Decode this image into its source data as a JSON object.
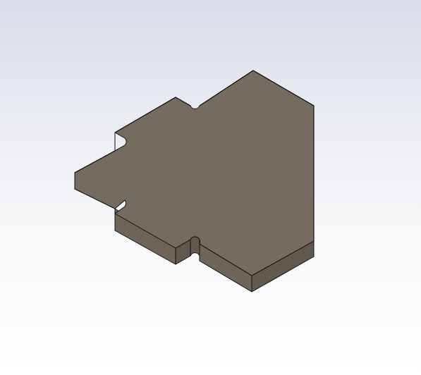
{
  "viewport": {
    "background_top": "#d8dce8",
    "background_bottom": "#ffffff"
  },
  "part": {
    "top_face_color": "#756b5f",
    "side_face_color": "#6e6458",
    "dark_face_color": "#62594e",
    "edge_color": "#111111"
  }
}
